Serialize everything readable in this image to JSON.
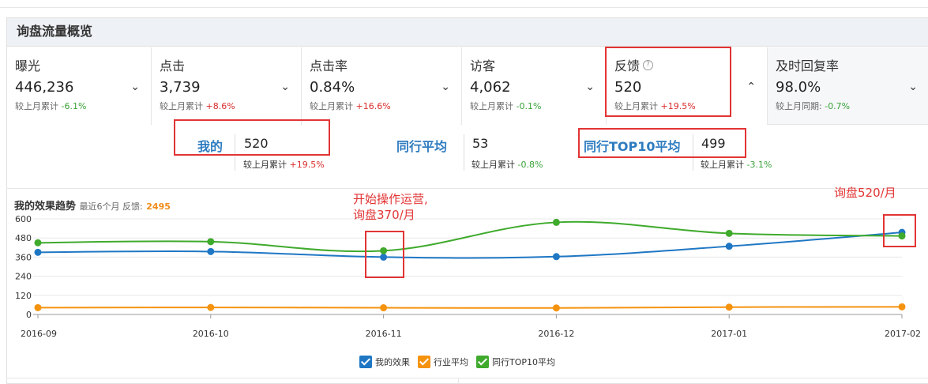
{
  "panel": {
    "title": "询盘流量概览"
  },
  "metrics": [
    {
      "name": "曝光",
      "value": "446,236",
      "cmp_label": "较上月累计",
      "cmp_value": "-6.1%",
      "trend": "down",
      "chevron": "⌄"
    },
    {
      "name": "点击",
      "value": "3,739",
      "cmp_label": "较上月累计",
      "cmp_value": "+8.6%",
      "trend": "up",
      "chevron": "⌄"
    },
    {
      "name": "点击率",
      "value": "0.84%",
      "cmp_label": "较上月累计",
      "cmp_value": "+16.6%",
      "trend": "up",
      "chevron": "⌄"
    },
    {
      "name": "访客",
      "value": "4,062",
      "cmp_label": "较上月累计",
      "cmp_value": "-0.1%",
      "trend": "down",
      "chevron": "⌄"
    },
    {
      "name": "反馈",
      "value": "520",
      "cmp_label": "较上月累计",
      "cmp_value": "+19.5%",
      "trend": "up",
      "chevron": "⌃"
    },
    {
      "name": "及时回复率",
      "value": "98.0%",
      "cmp_label": "较上月同期:",
      "cmp_value": "-0.7%",
      "trend": "down",
      "chevron": "⌄"
    }
  ],
  "compare": {
    "mine": {
      "label": "我的",
      "value": "520",
      "cmp_label": "较上月累计",
      "cmp_value": "+19.5%"
    },
    "peer_avg": {
      "label": "同行平均",
      "value": "53",
      "cmp_label": "较上月累计",
      "cmp_value": "-0.8%"
    },
    "top10_avg": {
      "label": "同行TOP10平均",
      "value": "499",
      "cmp_label": "较上月累计",
      "cmp_value": "-3.1%"
    }
  },
  "trend": {
    "title": "我的效果趋势",
    "subtitle": "最近6个月 反馈:",
    "total": "2495"
  },
  "annotations": {
    "start": [
      "开始操作运营,",
      "询盘370/月"
    ],
    "end": "询盘520/月"
  },
  "legend": [
    {
      "label": "我的效果",
      "color": "#1f77c4"
    },
    {
      "label": "行业平均",
      "color": "#f5930f"
    },
    {
      "label": "同行TOP10平均",
      "color": "#3faa2c"
    }
  ],
  "colors": {
    "up": "#d92c2c",
    "down": "#3aa23a",
    "accent": "#2f7cc0",
    "annotation": "#e23434"
  },
  "chart_data": {
    "type": "line",
    "x": [
      "2016-09",
      "2016-10",
      "2016-11",
      "2016-12",
      "2017-01",
      "2017-02"
    ],
    "ylim": [
      0,
      600
    ],
    "yticks": [
      "0",
      "120",
      "240",
      "360",
      "480",
      "600"
    ],
    "grid": true,
    "legend_position": "bottom-center",
    "series": [
      {
        "name": "我的效果",
        "color": "#1f77c4",
        "values": [
          390,
          395,
          360,
          363,
          428,
          515
        ]
      },
      {
        "name": "行业平均",
        "color": "#f5930f",
        "values": [
          43,
          44,
          42,
          41,
          46,
          48
        ]
      },
      {
        "name": "同行TOP10平均",
        "color": "#3faa2c",
        "values": [
          450,
          457,
          400,
          578,
          509,
          493
        ]
      }
    ]
  }
}
